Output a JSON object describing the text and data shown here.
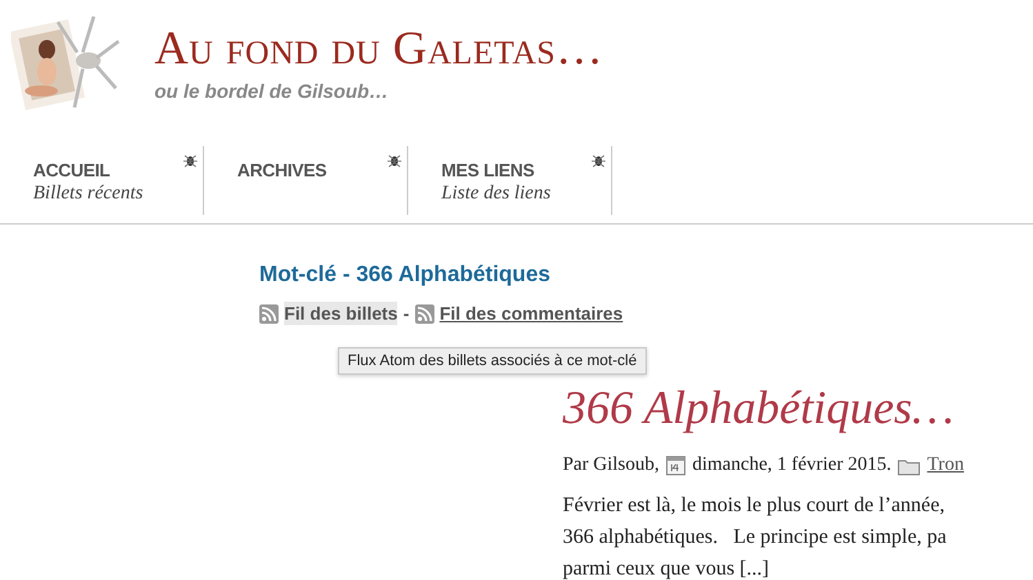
{
  "site": {
    "title": "Au fond du Galetas…",
    "tagline": "ou le bordel de Gilsoub…"
  },
  "nav": [
    {
      "label": "ACCUEIL",
      "sub": "Billets récents"
    },
    {
      "label": "ARCHIVES"
    },
    {
      "label": "MES LIENS",
      "sub": "Liste des liens"
    }
  ],
  "tag_heading": "Mot-clé - 366 Alphabétiques",
  "feeds": [
    {
      "label": "Fil des billets",
      "hovered": true
    },
    {
      "label": "Fil des commentaires",
      "hovered": false
    }
  ],
  "feed_separator": "-",
  "tooltip": "Flux Atom des billets associés à ce mot-clé",
  "post": {
    "title": "366 Alphabétiques…",
    "author": "Par Gilsoub,",
    "date": "dimanche, 1 février 2015.",
    "category": "Tron",
    "lines": [
      "Février est là, le mois le plus court de l’année,",
      "366 alphabétiques.   Le principe est simple, pa",
      "parmi ceux que vous [...]"
    ]
  }
}
